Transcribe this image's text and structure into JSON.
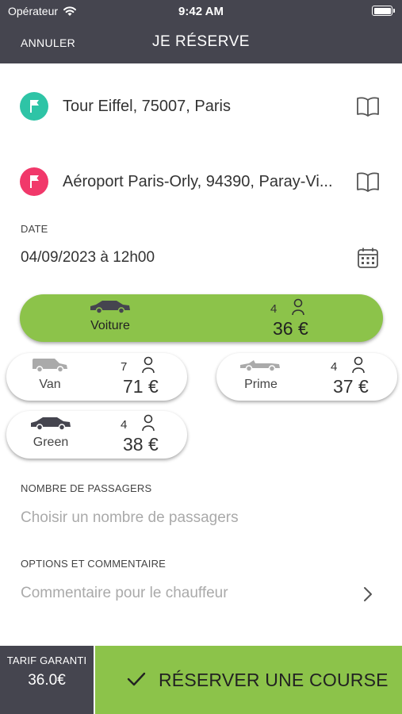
{
  "status_bar": {
    "carrier": "Opérateur",
    "time": "9:42 AM"
  },
  "nav": {
    "cancel_label": "ANNULER",
    "title": "JE RÉSERVE"
  },
  "addresses": {
    "departure": {
      "text": "Tour Eiffel, 75007, Paris",
      "color": "#2ec4a6"
    },
    "arrival": {
      "text": "Aéroport Paris-Orly, 94390, Paray-Vi...",
      "color": "#f1386a"
    }
  },
  "date": {
    "label": "DATE",
    "value": "04/09/2023 à 12h00"
  },
  "vehicles": [
    {
      "name": "Voiture",
      "seats": "4",
      "price": "36 €",
      "selected": true
    },
    {
      "name": "Van",
      "seats": "7",
      "price": "71 €",
      "selected": false
    },
    {
      "name": "Prime",
      "seats": "4",
      "price": "37 €",
      "selected": false
    },
    {
      "name": "Green",
      "seats": "4",
      "price": "38 €",
      "selected": false
    }
  ],
  "passengers": {
    "label": "NOMBRE DE PASSAGERS",
    "placeholder": "Choisir un nombre de passagers"
  },
  "options": {
    "label": "OPTIONS ET COMMENTAIRE",
    "placeholder": "Commentaire pour le chauffeur"
  },
  "footer": {
    "tarif_label": "TARIF GARANTI",
    "tarif_value": "36.0€",
    "reserve_label": "RÉSERVER UNE COURSE"
  },
  "colors": {
    "header": "#45454f",
    "accent_green": "#8cc34a",
    "departure_pin": "#2ec4a6",
    "arrival_pin": "#f1386a"
  },
  "icons": [
    "wifi-icon",
    "battery-icon",
    "flag-icon",
    "book-icon",
    "calendar-icon",
    "car-icon",
    "van-icon",
    "cabriolet-icon",
    "person-icon",
    "chevron-right-icon",
    "checkmark-icon"
  ]
}
